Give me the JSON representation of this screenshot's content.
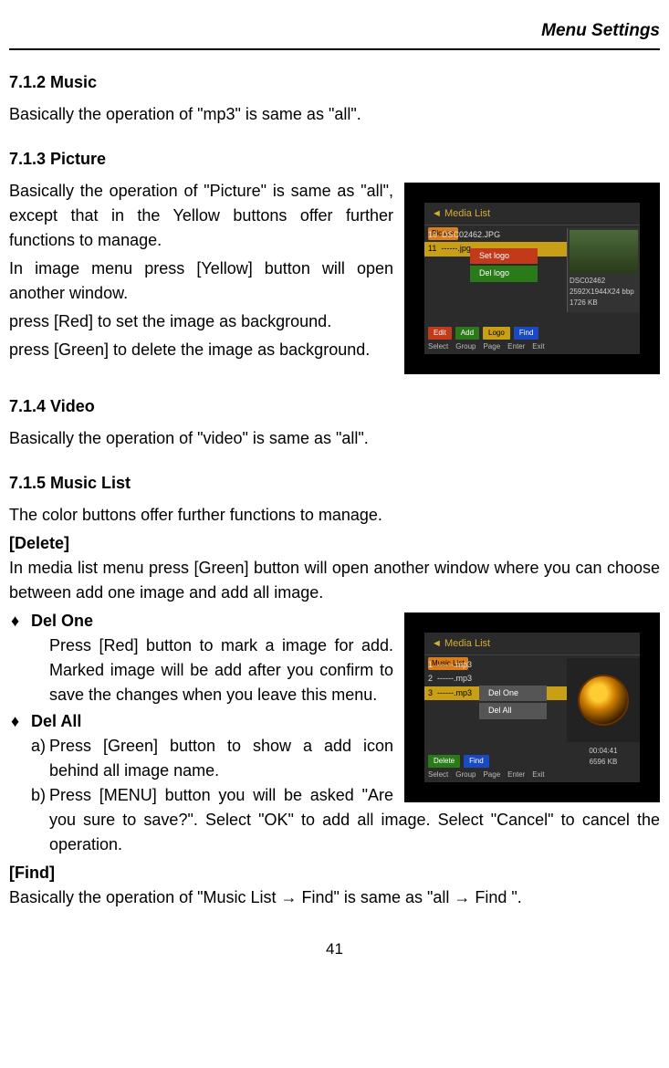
{
  "header": {
    "title": "Menu Settings"
  },
  "sections": {
    "music": {
      "heading": "7.1.2    Music",
      "body": "Basically the operation of \"mp3\" is same as \"all\"."
    },
    "picture": {
      "heading": "7.1.3    Picture",
      "p1": "Basically the operation of \"Picture\" is same as \"all\", except that in the Yellow buttons offer further functions to manage.",
      "p2": "In image menu press [Yellow] button will open another window.",
      "p3": "press [Red] to set the image as background.",
      "p4": "press [Green] to delete the image as background."
    },
    "video": {
      "heading": "7.1.4    Video",
      "body": "Basically the operation of \"video\" is same as \"all\"."
    },
    "musiclist": {
      "heading": "7.1.5    Music List",
      "intro": "The color buttons offer further functions to manage.",
      "delete_label": "[Delete]",
      "delete_body": "In media list menu press [Green] button will open another window where you can choose between add one image and add all image.",
      "del_one_title": "Del One",
      "del_one_body": "Press [Red] button to mark a image for add. Marked image will be add after you confirm to save the changes when you leave this menu.",
      "del_all_title": "Del All",
      "del_all_a_letter": "a)",
      "del_all_a": "Press [Green] button to show a add icon behind all image name.",
      "del_all_b_letter": "b)",
      "del_all_b": "Press [MENU] button you will be asked \"Are you sure to save?\". Select \"OK\" to add all image. Select \"Cancel\" to cancel the operation.",
      "find_label": "[Find]",
      "find_body": "Basically the operation of \"Music List → Find\" is same as \"all → Find \"."
    }
  },
  "figures": {
    "picture": {
      "title": "Media List",
      "tab": "Picture",
      "rows": [
        {
          "num": "10",
          "name": "DSC02462.JPG"
        },
        {
          "num": "11",
          "name": "------.jpg"
        }
      ],
      "popup": {
        "set": "Set logo",
        "del": "Del logo"
      },
      "info": {
        "name": "DSC02462",
        "dims": "2592X1944X24 bbp",
        "size": "1726 KB"
      },
      "footer_btns": {
        "edit": "Edit",
        "add": "Add",
        "logo": "Logo",
        "find": "Find"
      },
      "footer_nav": {
        "select": "Select",
        "group": "Group",
        "page": "Page",
        "enter": "Enter",
        "exit": "Exit"
      }
    },
    "musiclist": {
      "title": "Media List",
      "tab": "Music List",
      "rows": [
        {
          "num": "1",
          "name": "------.mp3"
        },
        {
          "num": "2",
          "name": "------.mp3"
        },
        {
          "num": "3",
          "name": "------.mp3"
        }
      ],
      "popup": {
        "one": "Del One",
        "all": "Del All"
      },
      "info": {
        "time": "00:04:41",
        "size": "6596 KB"
      },
      "footer_btns": {
        "delete": "Delete",
        "find": "Find"
      },
      "footer_nav": {
        "select": "Select",
        "group": "Group",
        "page": "Page",
        "enter": "Enter",
        "exit": "Exit"
      }
    }
  },
  "page_number": "41"
}
